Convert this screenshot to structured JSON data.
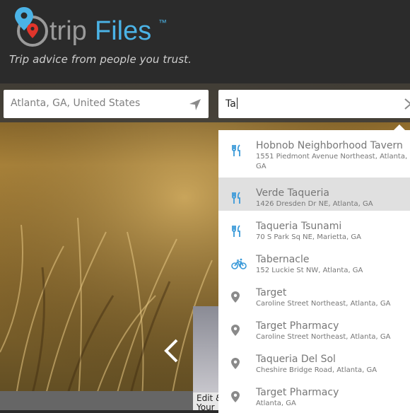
{
  "app": {
    "brand": "tripFiles",
    "trademark": "™",
    "tagline": "Trip advice from people you trust."
  },
  "search": {
    "location_value": "Atlanta, GA, United States",
    "query_value": "Ta"
  },
  "suggestions": [
    {
      "name": "Hobnob Neighborhood Tavern",
      "address": "1551 Piedmont Avenue Northeast, Atlanta, GA",
      "icon": "restaurant-icon",
      "active": false
    },
    {
      "name": "Verde Taqueria",
      "address": "1426 Dresden Dr NE, Atlanta, GA",
      "icon": "restaurant-icon",
      "active": true
    },
    {
      "name": "Taqueria Tsunami",
      "address": "70 S Park Sq NE, Marietta, GA",
      "icon": "restaurant-icon",
      "active": false
    },
    {
      "name": "Tabernacle",
      "address": "152 Luckie St NW, Atlanta, GA",
      "icon": "bicycle-icon",
      "active": false
    },
    {
      "name": "Target",
      "address": "Caroline Street Northeast, Atlanta, GA",
      "icon": "location-pin-icon",
      "active": false
    },
    {
      "name": "Target Pharmacy",
      "address": "Caroline Street Northeast, Atlanta, GA",
      "icon": "location-pin-icon",
      "active": false
    },
    {
      "name": "Taqueria Del Sol",
      "address": "Cheshire Bridge Road, Atlanta, GA",
      "icon": "location-pin-icon",
      "active": false
    },
    {
      "name": "Target Pharmacy",
      "address": "Atlanta, GA",
      "icon": "location-pin-icon",
      "active": false
    }
  ],
  "card": {
    "text_line1": "Edit &",
    "text_line2": "Your"
  },
  "colors": {
    "brand_blue": "#4bb3e6",
    "pin_red": "#e0352b",
    "header_bg": "#2b2b2b",
    "icon_blue": "#3b9ad9",
    "icon_gray": "#8a8a8a"
  }
}
